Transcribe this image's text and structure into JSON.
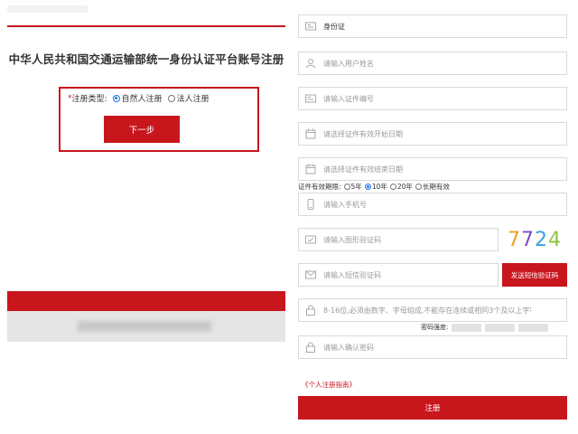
{
  "left": {
    "title": "中华人民共和国交通运输部统一身份认证平台账号注册",
    "reg_type_label": "注册类型:",
    "reg_types": [
      {
        "label": "自然人注册",
        "checked": true
      },
      {
        "label": "法人注册",
        "checked": false
      }
    ],
    "next_button": "下一步"
  },
  "form": {
    "id_type": "身份证",
    "name_placeholder": "请输入用户姓名",
    "id_number_placeholder": "请输入证件编号",
    "start_date_placeholder": "请选择证件有效开始日期",
    "end_date_placeholder": "请选择证件有效结束日期",
    "validity_label": "证件有效期限:",
    "validity_options": [
      {
        "label": "5年",
        "checked": false
      },
      {
        "label": "10年",
        "checked": true
      },
      {
        "label": "20年",
        "checked": false
      },
      {
        "label": "长期有效",
        "checked": false
      }
    ],
    "phone_placeholder": "请输入手机号",
    "captcha_placeholder": "请输入图形验证码",
    "captcha_code": "7724",
    "sms_placeholder": "请输入短信验证码",
    "sms_button": "发送短信验证码",
    "password_placeholder": "8-16位,必须由数字、字母组成,不能存在连续或相同3个及以上字符",
    "strength_label": "密码强度:",
    "confirm_placeholder": "请输入确认密码",
    "guide_link": "《个人注册指南》",
    "register_button": "注册"
  },
  "colors": {
    "accent_red": "#c8161d",
    "radio_blue": "#1a73e8",
    "captcha_digits": [
      "#f0a020",
      "#7a4ec8",
      "#3aa0e0",
      "#8cc63f"
    ]
  }
}
